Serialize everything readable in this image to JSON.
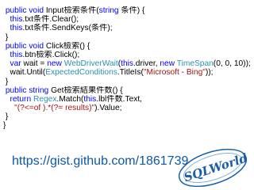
{
  "code_lines": [
    [
      {
        "t": " ",
        "c": "pl"
      },
      {
        "t": "public",
        "c": "kw"
      },
      {
        "t": " ",
        "c": "pl"
      },
      {
        "t": "void",
        "c": "kw"
      },
      {
        "t": " Input檢索条件(",
        "c": "pl"
      },
      {
        "t": "string",
        "c": "kw"
      },
      {
        "t": " 条件) {",
        "c": "pl"
      }
    ],
    [
      {
        "t": "   ",
        "c": "pl"
      },
      {
        "t": "this",
        "c": "kw"
      },
      {
        "t": ".txt条件.Clear();",
        "c": "pl"
      }
    ],
    [
      {
        "t": "   ",
        "c": "pl"
      },
      {
        "t": "this",
        "c": "kw"
      },
      {
        "t": ".txt条件.SendKeys(条件);",
        "c": "pl"
      }
    ],
    [
      {
        "t": " }",
        "c": "pl"
      }
    ],
    [
      {
        "t": " ",
        "c": "pl"
      },
      {
        "t": "public",
        "c": "kw"
      },
      {
        "t": " ",
        "c": "pl"
      },
      {
        "t": "void",
        "c": "kw"
      },
      {
        "t": " Click檢索() {",
        "c": "pl"
      }
    ],
    [
      {
        "t": "   ",
        "c": "pl"
      },
      {
        "t": "this",
        "c": "kw"
      },
      {
        "t": ".btn檢索.Click();",
        "c": "pl"
      }
    ],
    [
      {
        "t": "   ",
        "c": "pl"
      },
      {
        "t": "var",
        "c": "kw"
      },
      {
        "t": " wait = ",
        "c": "pl"
      },
      {
        "t": "new",
        "c": "kw"
      },
      {
        "t": " ",
        "c": "pl"
      },
      {
        "t": "WebDriverWait",
        "c": "ty"
      },
      {
        "t": "(",
        "c": "pl"
      },
      {
        "t": "this",
        "c": "kw"
      },
      {
        "t": ".driver, ",
        "c": "pl"
      },
      {
        "t": "new",
        "c": "kw"
      },
      {
        "t": " ",
        "c": "pl"
      },
      {
        "t": "TimeSpan",
        "c": "ty"
      },
      {
        "t": "(0, 0, 10));",
        "c": "pl"
      }
    ],
    [
      {
        "t": "   wait.Until(",
        "c": "pl"
      },
      {
        "t": "ExpectedConditions",
        "c": "ty"
      },
      {
        "t": ".TitleIs(",
        "c": "pl"
      },
      {
        "t": "\"Microsoft - Bing\"",
        "c": "st"
      },
      {
        "t": "));",
        "c": "pl"
      }
    ],
    [
      {
        "t": " }",
        "c": "pl"
      }
    ],
    [
      {
        "t": " ",
        "c": "pl"
      },
      {
        "t": "public",
        "c": "kw"
      },
      {
        "t": " ",
        "c": "pl"
      },
      {
        "t": "string",
        "c": "kw"
      },
      {
        "t": " Get檢索結果件数() {",
        "c": "pl"
      }
    ],
    [
      {
        "t": "   ",
        "c": "pl"
      },
      {
        "t": "return",
        "c": "kw"
      },
      {
        "t": " ",
        "c": "pl"
      },
      {
        "t": "Regex",
        "c": "ty"
      },
      {
        "t": ".Match(",
        "c": "pl"
      },
      {
        "t": "this",
        "c": "kw"
      },
      {
        "t": ".lbl件数.Text,",
        "c": "pl"
      }
    ],
    [
      {
        "t": "     ",
        "c": "pl"
      },
      {
        "t": "\"(?<=of ).*(?= results)\"",
        "c": "st"
      },
      {
        "t": ").Value;",
        "c": "pl"
      }
    ],
    [
      {
        "t": " }",
        "c": "pl"
      }
    ],
    [
      {
        "t": "}",
        "c": "pl"
      }
    ]
  ],
  "footer": {
    "url": "https://gist.github.com/1861739"
  },
  "logo": {
    "text": "SQLWorld"
  },
  "colors": {
    "keyword": "#0000ff",
    "type": "#2b91af",
    "string": "#a31515",
    "plain": "#000000",
    "link": "#0b57a8",
    "logo": "#1a5fa8"
  }
}
